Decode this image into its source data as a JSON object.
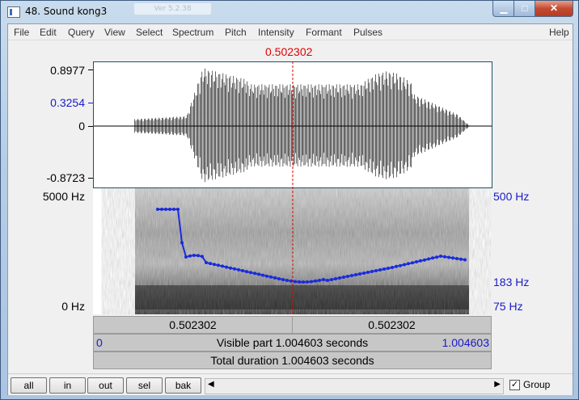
{
  "window": {
    "title": "48. Sound kong3",
    "ghost_text": "Ver 5.2.38",
    "controls": {
      "minimize": "▁",
      "maximize": "□",
      "close": "✕"
    }
  },
  "menu": [
    "File",
    "Edit",
    "Query",
    "View",
    "Select",
    "Spectrum",
    "Pitch",
    "Intensity",
    "Formant",
    "Pulses",
    "Help"
  ],
  "cursor": {
    "time_label": "0.502302"
  },
  "waveform": {
    "max_label": "0.8977",
    "cursor_value_label": "0.3254",
    "zero_label": "0",
    "min_label": "-0.8723"
  },
  "spectrogram": {
    "top_freq_label": "5000 Hz",
    "bottom_freq_label": "0 Hz",
    "pitch_top_label": "500 Hz",
    "pitch_cursor_label": "183 Hz",
    "pitch_bottom_label": "75 Hz"
  },
  "time_bars": {
    "left_segment": "0.502302",
    "right_segment": "0.502302",
    "visible_start": "0",
    "visible_text": "Visible part 1.004603 seconds",
    "visible_end": "1.004603",
    "total_text": "Total duration 1.004603 seconds"
  },
  "bottom_buttons": [
    "all",
    "in",
    "out",
    "sel",
    "bak"
  ],
  "group": {
    "checked": true,
    "mark": "✓",
    "label": "Group"
  },
  "colors": {
    "cursor": "#e00000",
    "pitch": "#1a2bdc",
    "axis_blue": "#1a1ac8"
  }
}
